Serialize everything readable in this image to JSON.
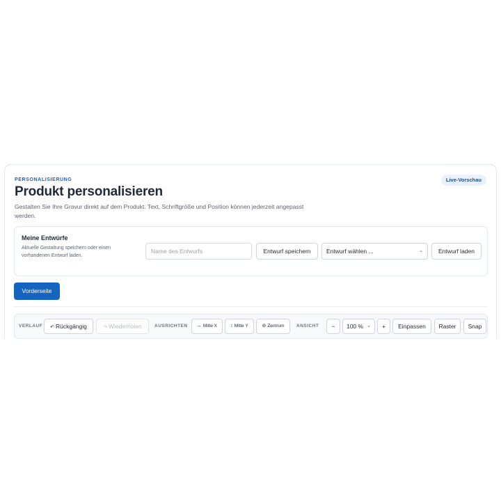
{
  "header": {
    "eyebrow": "PERSONALISIERUNG",
    "badge": "Live-Vorschau",
    "title": "Produkt personalisieren",
    "subtitle": "Gestalten Sie Ihre Gravur direkt auf dem Produkt. Text, Schriftgröße und Position können jederzeit angepasst werden."
  },
  "drafts": {
    "title": "Meine Entwürfe",
    "description": "Aktuelle Gestaltung speichern oder einen vorhandenen Entwurf laden.",
    "name_input": {
      "value": "",
      "placeholder": "Name des Entwurfs"
    },
    "save_label": "Entwurf speichern",
    "select_value": "Entwurf wählen ...",
    "load_label": "Entwurf laden"
  },
  "side_tab": {
    "label": "Vorderseite"
  },
  "toolbar": {
    "history_label": "VERLAUF",
    "undo": {
      "icon": "undo-arrow-icon",
      "glyph": "↶",
      "label": "Rückgängig"
    },
    "redo": {
      "icon": "redo-arrow-icon",
      "glyph": "↷",
      "label": "Wiederholen"
    },
    "align_label": "AUSRICHTEN",
    "center_x": {
      "icon": "horizontal-arrows-icon",
      "glyph": "↔",
      "label": "Mitte X"
    },
    "center_y": {
      "icon": "vertical-arrows-icon",
      "glyph": "↕",
      "label": "Mitte Y"
    },
    "center": {
      "icon": "target-icon",
      "glyph": "⊚",
      "label": "Zentrum"
    },
    "view_label": "ANSICHT",
    "zoom_out": "−",
    "zoom_value": "100 %",
    "zoom_in": "+",
    "fit_label": "Einpassen",
    "grid_label": "Raster",
    "snap_label": "Snap"
  },
  "colors": {
    "accent": "#1565c0",
    "badge_bg": "#e8f1fc"
  }
}
